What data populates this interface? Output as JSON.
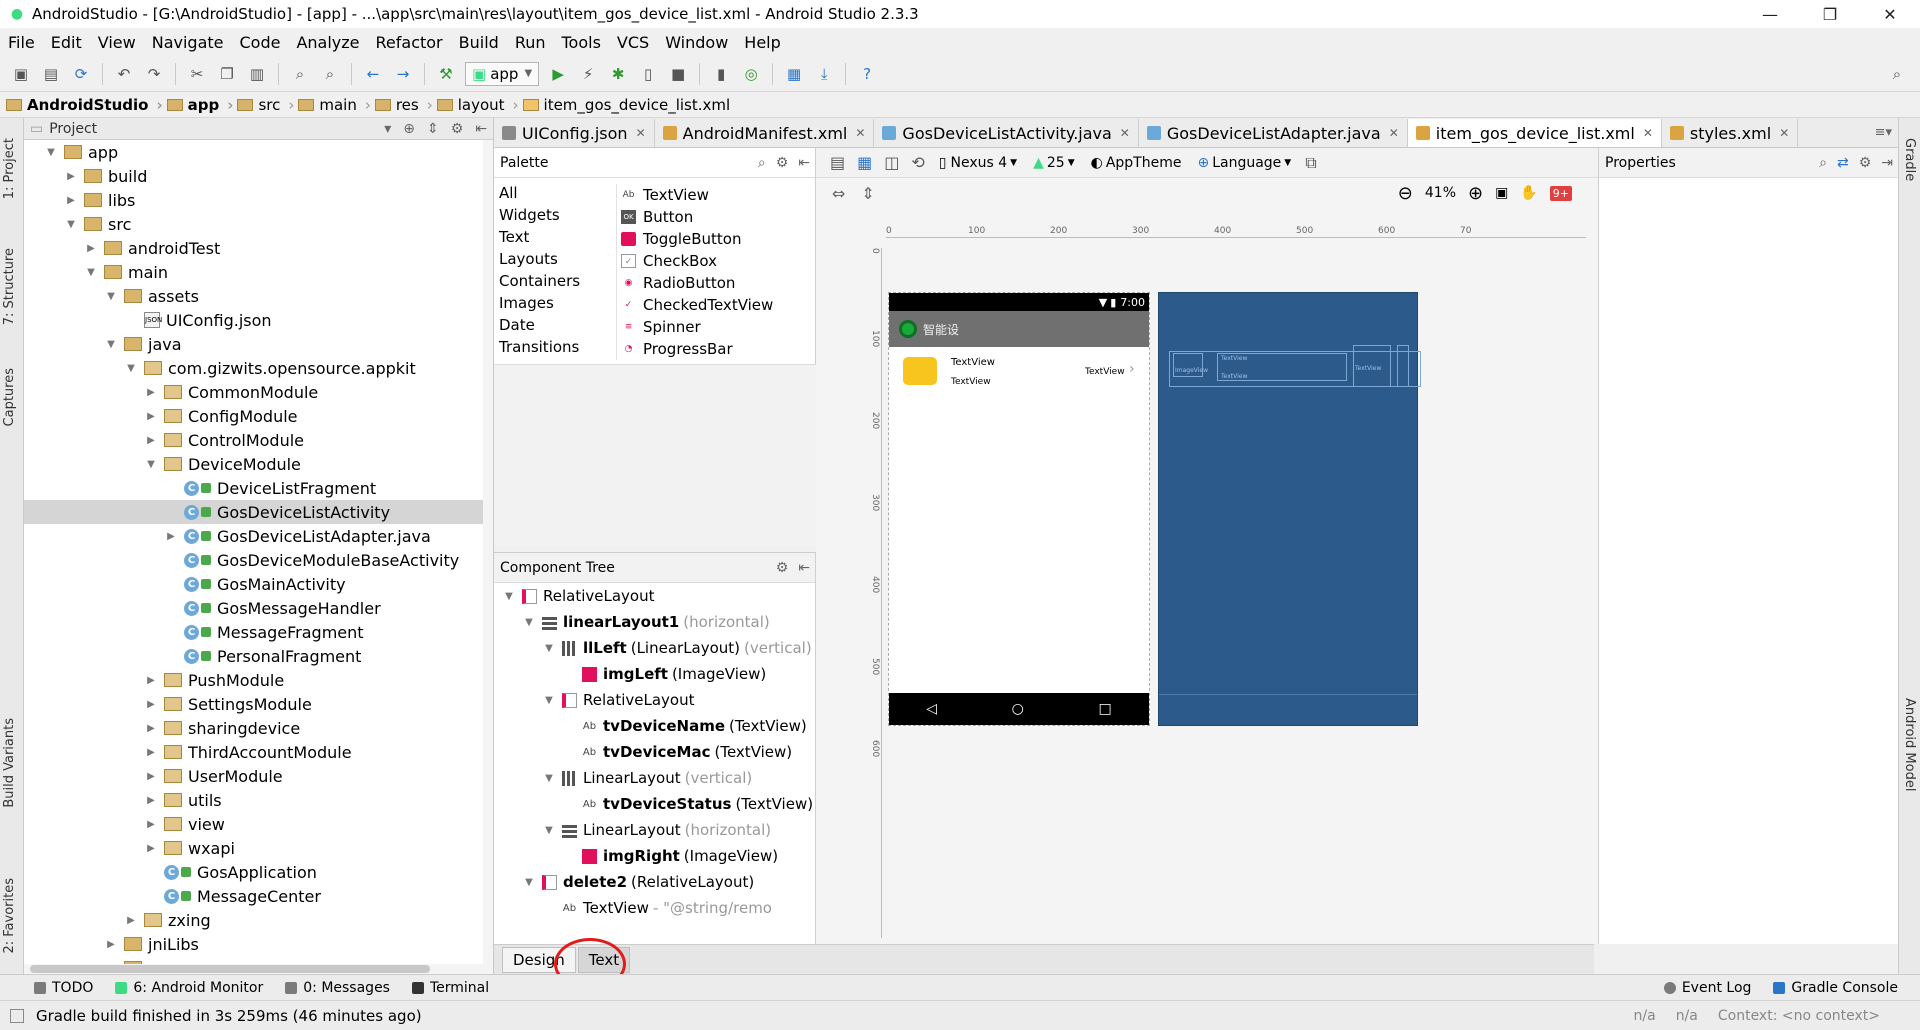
{
  "window": {
    "title": "AndroidStudio - [G:\\AndroidStudio] - [app] - ...\\app\\src\\main\\res\\layout\\item_gos_device_list.xml - Android Studio 2.3.3",
    "minimize": "—",
    "maximize": "❐",
    "close": "✕"
  },
  "menu": [
    "File",
    "Edit",
    "View",
    "Navigate",
    "Code",
    "Analyze",
    "Refactor",
    "Build",
    "Run",
    "Tools",
    "VCS",
    "Window",
    "Help"
  ],
  "toolbar": {
    "run_config": "app",
    "help": "?"
  },
  "breadcrumb": [
    "AndroidStudio",
    "app",
    "src",
    "main",
    "res",
    "layout",
    "item_gos_device_list.xml"
  ],
  "left_strip": [
    "1: Project",
    "7: Structure",
    "Captures",
    "Build Variants",
    "2: Favorites"
  ],
  "right_strip": [
    "Gradle",
    "Android Model"
  ],
  "project_panel": {
    "header": "Project",
    "tree": [
      {
        "label": "app",
        "level": 1,
        "kind": "folder",
        "expanded": true
      },
      {
        "label": "build",
        "level": 2,
        "kind": "folder"
      },
      {
        "label": "libs",
        "level": 2,
        "kind": "folder"
      },
      {
        "label": "src",
        "level": 2,
        "kind": "folder",
        "expanded": true
      },
      {
        "label": "androidTest",
        "level": 3,
        "kind": "folder"
      },
      {
        "label": "main",
        "level": 3,
        "kind": "folder",
        "expanded": true
      },
      {
        "label": "assets",
        "level": 4,
        "kind": "folder",
        "expanded": true
      },
      {
        "label": "UIConfig.json",
        "level": 5,
        "kind": "json"
      },
      {
        "label": "java",
        "level": 4,
        "kind": "folder",
        "expanded": true
      },
      {
        "label": "com.gizwits.opensource.appkit",
        "level": 5,
        "kind": "pkg",
        "expanded": true
      },
      {
        "label": "CommonModule",
        "level": 6,
        "kind": "pkg"
      },
      {
        "label": "ConfigModule",
        "level": 6,
        "kind": "pkg"
      },
      {
        "label": "ControlModule",
        "level": 6,
        "kind": "pkg"
      },
      {
        "label": "DeviceModule",
        "level": 6,
        "kind": "pkg",
        "expanded": true
      },
      {
        "label": "DeviceListFragment",
        "level": 7,
        "kind": "class"
      },
      {
        "label": "GosDeviceListActivity",
        "level": 7,
        "kind": "class",
        "selected": true
      },
      {
        "label": "GosDeviceListAdapter.java",
        "level": 7,
        "kind": "class",
        "collapsed": true
      },
      {
        "label": "GosDeviceModuleBaseActivity",
        "level": 7,
        "kind": "class"
      },
      {
        "label": "GosMainActivity",
        "level": 7,
        "kind": "class"
      },
      {
        "label": "GosMessageHandler",
        "level": 7,
        "kind": "class"
      },
      {
        "label": "MessageFragment",
        "level": 7,
        "kind": "class"
      },
      {
        "label": "PersonalFragment",
        "level": 7,
        "kind": "class"
      },
      {
        "label": "PushModule",
        "level": 6,
        "kind": "pkg"
      },
      {
        "label": "SettingsModule",
        "level": 6,
        "kind": "pkg"
      },
      {
        "label": "sharingdevice",
        "level": 6,
        "kind": "pkg"
      },
      {
        "label": "ThirdAccountModule",
        "level": 6,
        "kind": "pkg"
      },
      {
        "label": "UserModule",
        "level": 6,
        "kind": "pkg"
      },
      {
        "label": "utils",
        "level": 6,
        "kind": "pkg"
      },
      {
        "label": "view",
        "level": 6,
        "kind": "pkg"
      },
      {
        "label": "wxapi",
        "level": 6,
        "kind": "pkg"
      },
      {
        "label": "GosApplication",
        "level": 6,
        "kind": "class"
      },
      {
        "label": "MessageCenter",
        "level": 6,
        "kind": "class"
      },
      {
        "label": "zxing",
        "level": 5,
        "kind": "pkg"
      },
      {
        "label": "jniLibs",
        "level": 4,
        "kind": "folder"
      },
      {
        "label": "res",
        "level": 4,
        "kind": "folder"
      }
    ]
  },
  "editor_tabs": [
    {
      "label": "UIConfig.json",
      "color": "#8a8a8a",
      "active": false
    },
    {
      "label": "AndroidManifest.xml",
      "color": "#d9a441",
      "active": false
    },
    {
      "label": "GosDeviceListActivity.java",
      "color": "#6aa9d8",
      "active": false
    },
    {
      "label": "GosDeviceListAdapter.java",
      "color": "#6aa9d8",
      "active": false
    },
    {
      "label": "item_gos_device_list.xml",
      "color": "#d9a441",
      "active": true
    },
    {
      "label": "styles.xml",
      "color": "#d9a441",
      "active": false
    }
  ],
  "palette": {
    "header": "Palette",
    "categories": [
      "All",
      "Widgets",
      "Text",
      "Layouts",
      "Containers",
      "Images",
      "Date",
      "Transitions"
    ],
    "items": [
      {
        "icon": "Ab",
        "label": "TextView"
      },
      {
        "icon": "OK",
        "label": "Button"
      },
      {
        "icon": "",
        "label": "ToggleButton"
      },
      {
        "icon": "✓",
        "label": "CheckBox"
      },
      {
        "icon": "◉",
        "label": "RadioButton"
      },
      {
        "icon": "✓",
        "label": "CheckedTextView"
      },
      {
        "icon": "≡",
        "label": "Spinner"
      },
      {
        "icon": "◔",
        "label": "ProgressBar"
      }
    ]
  },
  "component_tree": {
    "header": "Component Tree",
    "rows": [
      {
        "level": 0,
        "arrow": "▼",
        "icon": "rel",
        "name": "",
        "type": "RelativeLayout",
        "muted": ""
      },
      {
        "level": 1,
        "arrow": "▼",
        "icon": "linh",
        "name": "linearLayout1",
        "type": "",
        "muted": "(horizontal)"
      },
      {
        "level": 2,
        "arrow": "▼",
        "icon": "lin",
        "name": "llLeft",
        "type": "(LinearLayout)",
        "muted": "(vertical)"
      },
      {
        "level": 3,
        "arrow": "",
        "icon": "img",
        "name": "imgLeft",
        "type": "(ImageView)",
        "muted": ""
      },
      {
        "level": 2,
        "arrow": "▼",
        "icon": "rel",
        "name": "",
        "type": "RelativeLayout",
        "muted": ""
      },
      {
        "level": 3,
        "arrow": "",
        "icon": "tv",
        "name": "tvDeviceName",
        "type": "(TextView)",
        "muted": ""
      },
      {
        "level": 3,
        "arrow": "",
        "icon": "tv",
        "name": "tvDeviceMac",
        "type": "(TextView)",
        "muted": ""
      },
      {
        "level": 2,
        "arrow": "▼",
        "icon": "lin",
        "name": "",
        "type": "LinearLayout",
        "muted": "(vertical)"
      },
      {
        "level": 3,
        "arrow": "",
        "icon": "tv",
        "name": "tvDeviceStatus",
        "type": "(TextView)",
        "muted": ""
      },
      {
        "level": 2,
        "arrow": "▼",
        "icon": "linh",
        "name": "",
        "type": "LinearLayout",
        "muted": "(horizontal)"
      },
      {
        "level": 3,
        "arrow": "",
        "icon": "img",
        "name": "imgRight",
        "type": "(ImageView)",
        "muted": ""
      },
      {
        "level": 1,
        "arrow": "▼",
        "icon": "rel",
        "name": "delete2",
        "type": "(RelativeLayout)",
        "muted": ""
      },
      {
        "level": 2,
        "arrow": "",
        "icon": "tv",
        "name": "",
        "type": "TextView",
        "muted": "- \"@string/remo"
      }
    ]
  },
  "design": {
    "device": "Nexus 4",
    "api": "25",
    "theme": "AppTheme",
    "language": "Language",
    "zoom": "41%",
    "badge": "9+",
    "ruler_h": [
      "0",
      "100",
      "200",
      "300",
      "400",
      "500",
      "600",
      "70"
    ],
    "ruler_v": [
      "0",
      "100",
      "200",
      "300",
      "400",
      "500",
      "600"
    ],
    "phone": {
      "time": "7:00",
      "app_title": "智能设",
      "device_name": "TextView",
      "device_mac": "TextView",
      "device_status": "TextView",
      "nav_back": "◁",
      "nav_home": "○",
      "nav_recent": "□"
    },
    "blueprint": {
      "image_label": "ImageView",
      "tv1": "TextView",
      "tv2": "TextView",
      "tv3": "TextView"
    }
  },
  "bottom_tabs": {
    "design": "Design",
    "text": "Text"
  },
  "properties": {
    "header": "Properties"
  },
  "tool_windows": {
    "left": [
      "TODO",
      "6: Android Monitor",
      "0: Messages",
      "Terminal"
    ],
    "right": [
      "Event Log",
      "Gradle Console"
    ]
  },
  "status": {
    "message": "Gradle build finished in 3s 259ms (46 minutes ago)",
    "col1": "n/a",
    "col2": "n/a",
    "context": "Context: <no context>"
  }
}
